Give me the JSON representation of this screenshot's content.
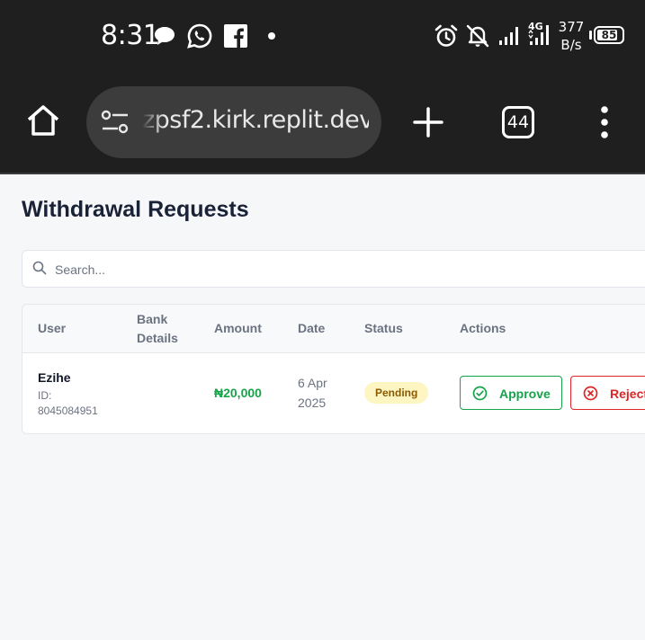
{
  "status_bar": {
    "time": "8:31",
    "net_speed_value": "377",
    "net_speed_unit": "B/s",
    "network_type": "4G",
    "battery_level": "85",
    "battery_fraction": 0.85,
    "icons": [
      "chat-bubble-icon",
      "whatsapp-icon",
      "facebook-icon",
      "notification-dot-icon",
      "alarm-icon",
      "bell-off-icon",
      "signal-icon",
      "signal-4g-icon",
      "battery-icon"
    ]
  },
  "browser": {
    "url_display": "zpsf2.kirk.replit.dev",
    "tab_count": "44",
    "icons": [
      "home-icon",
      "site-settings-icon",
      "new-tab-plus-icon",
      "tabs-icon",
      "overflow-menu-icon"
    ]
  },
  "page": {
    "title": "Withdrawal Requests",
    "search": {
      "placeholder": "Search...",
      "value": ""
    },
    "table": {
      "columns": [
        "User",
        "Bank Details",
        "Amount",
        "Date",
        "Status",
        "Actions"
      ],
      "rows": [
        {
          "user_name": "Ezihe",
          "user_id_label": "ID:",
          "user_id": "8045084951",
          "bank_details": "",
          "amount": "₦20,000",
          "date": "6 Apr 2025",
          "status": "Pending",
          "approve_label": "Approve",
          "reject_label": "Reject"
        }
      ]
    }
  },
  "colors": {
    "status_bar_bg": "#1f1f1f",
    "url_bar_bg": "#3c3c3c",
    "page_bg": "#f6f7f9",
    "title": "#1a2238",
    "amount_green": "#16a34a",
    "approve_green": "#16a34a",
    "reject_red": "#dc2626",
    "pending_badge_bg": "#fdf6c3",
    "pending_badge_text": "#8a5a00"
  }
}
